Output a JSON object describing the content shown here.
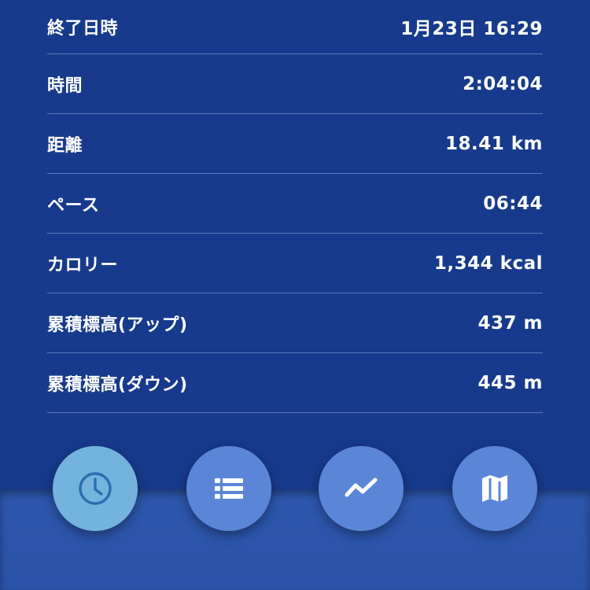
{
  "stats": [
    {
      "label": "終了日時",
      "value": "1月23日 16:29"
    },
    {
      "label": "時間",
      "value": "2:04:04"
    },
    {
      "label": "距離",
      "value": "18.41 km"
    },
    {
      "label": "ペース",
      "value": "06:44"
    },
    {
      "label": "カロリー",
      "value": "1,344 kcal"
    },
    {
      "label": "累積標高(アップ)",
      "value": "437 m"
    },
    {
      "label": "累積標高(ダウン)",
      "value": "445 m"
    }
  ],
  "nav": {
    "items": [
      {
        "icon": "clock-icon",
        "active": true
      },
      {
        "icon": "list-icon",
        "active": false
      },
      {
        "icon": "chart-icon",
        "active": false
      },
      {
        "icon": "map-icon",
        "active": false
      }
    ]
  },
  "colors": {
    "background": "#173a8c",
    "bottom_panel": "#2d57ad",
    "button": "#5b86d8",
    "button_active": "#74b3de",
    "text": "#ffffff"
  }
}
